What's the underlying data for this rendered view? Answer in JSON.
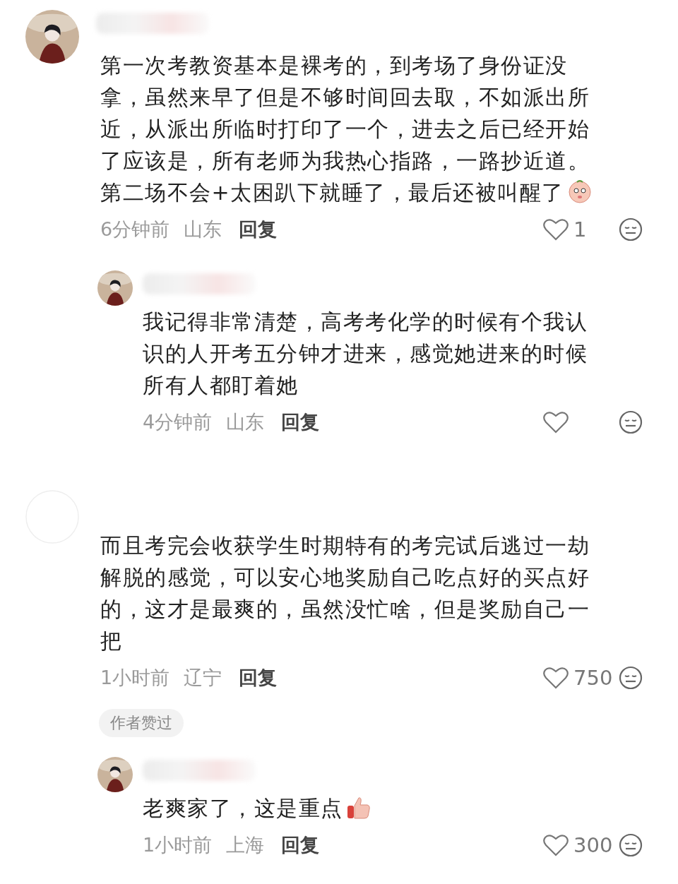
{
  "comments": [
    {
      "avatar": {
        "kind": "picture"
      },
      "name_hidden": true,
      "lines": [
        "第一次考教资基本是裸考的，到考场了身份证没",
        "拿，虽然来早了但是不够时间回去取，不如派出所",
        "近，从派出所临时打印了一个，进去之后已经开始",
        "了应该是，所有老师为我热心指路，一路抄近道。",
        "第二场不会+太困趴下就睡了，最后还被叫醒了"
      ],
      "emoji": {
        "kind": "blushing"
      },
      "time": "6分钟前",
      "location": "山东",
      "reply": "回复",
      "likes": "1",
      "replies": [
        {
          "avatar": {
            "kind": "picture"
          },
          "name_hidden": true,
          "lines": [
            "我记得非常清楚，高考考化学的时候有个我认",
            "识的人开考五分钟才进来，感觉她进来的时候",
            "所有人都盯着她"
          ],
          "time": "4分钟前",
          "location": "山东",
          "reply": "回复"
        }
      ]
    },
    {
      "avatar": {
        "kind": "blank"
      },
      "name_hidden": false,
      "lines": [
        "而且考完会收获学生时期特有的考完试后逃过一劫",
        "解脱的感觉，可以安心地奖励自己吃点好的买点好",
        "的，这才是最爽的，虽然没忙啥，但是奖励自己一",
        "把"
      ],
      "time": "1小时前",
      "location": "辽宁",
      "reply": "回复",
      "likes": "750",
      "badge": "作者赞过",
      "replies": [
        {
          "avatar": {
            "kind": "picture"
          },
          "name_hidden": true,
          "lines": [
            "老爽家了，这是重点"
          ],
          "emoji": {
            "kind": "thumb"
          },
          "time": "1小时前",
          "location": "上海",
          "reply": "回复",
          "likes": "300"
        }
      ]
    }
  ]
}
